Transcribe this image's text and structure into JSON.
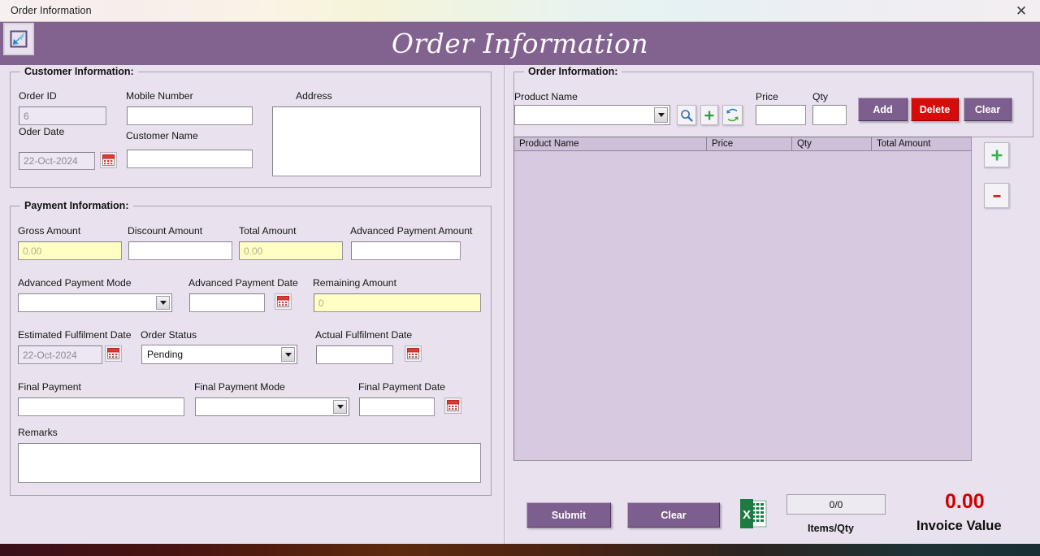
{
  "window": {
    "title": "Order Information",
    "close_label": "✕",
    "app_icon": "download-arrow-icon"
  },
  "header": {
    "title": "Order Information",
    "background_color": "#82638f",
    "text_color": "#fdfbff"
  },
  "customer_group": {
    "title": "Customer Information:",
    "order_id": {
      "label": "Order ID",
      "value": "6",
      "readonly": true
    },
    "order_date": {
      "label": "Oder Date",
      "value": "22-Oct-2024",
      "readonly": true
    },
    "mobile_number": {
      "label": "Mobile Number",
      "value": ""
    },
    "customer_name": {
      "label": "Customer Name",
      "value": ""
    },
    "address": {
      "label": "Address",
      "value": ""
    }
  },
  "payment_group": {
    "title": "Payment Information:",
    "gross_amount": {
      "label": "Gross Amount",
      "value": "0.00",
      "style": "yellow-readonly"
    },
    "discount_amount": {
      "label": "Discount Amount",
      "value": ""
    },
    "total_amount": {
      "label": "Total Amount",
      "value": "0.00",
      "style": "yellow-readonly"
    },
    "advanced_payment_amount": {
      "label": "Advanced Payment Amount",
      "value": ""
    },
    "advanced_payment_mode": {
      "label": "Advanced Payment Mode",
      "value": "",
      "options": []
    },
    "advanced_payment_date": {
      "label": "Advanced Payment Date",
      "value": ""
    },
    "remaining_amount": {
      "label": "Remaining Amount",
      "value": "0",
      "style": "yellow-readonly"
    },
    "estimated_fulfilment_date": {
      "label": "Estimated Fulfilment Date",
      "value": "22-Oct-2024",
      "readonly": true
    },
    "order_status": {
      "label": "Order Status",
      "value": "Pending",
      "options": [
        "Pending"
      ]
    },
    "actual_fulfilment_date": {
      "label": "Actual Fulfilment Date",
      "value": ""
    },
    "final_payment": {
      "label": "Final Payment",
      "value": ""
    },
    "final_payment_mode": {
      "label": "Final Payment Mode",
      "value": "",
      "options": []
    },
    "final_payment_date": {
      "label": "Final Payment Date",
      "value": ""
    },
    "remarks": {
      "label": "Remarks",
      "value": ""
    }
  },
  "order_group": {
    "title": "Order Information:",
    "product_name": {
      "label": "Product Name",
      "value": "",
      "options": []
    },
    "price": {
      "label": "Price",
      "value": ""
    },
    "qty": {
      "label": "Qty",
      "value": ""
    },
    "search_icon": "magnifier-icon",
    "add_product_icon": "green-plus-icon",
    "refresh_icon": "refresh-arrows-icon",
    "buttons": {
      "add": {
        "label": "Add",
        "color": "#7d5f8f"
      },
      "delete": {
        "label": "Delete",
        "color": "#d80b0b"
      },
      "clear": {
        "label": "Clear",
        "color": "#7d5f8f"
      }
    },
    "grid": {
      "columns": [
        "Product Name",
        "Price",
        "Qty",
        "Total Amount"
      ],
      "rows": []
    },
    "row_add_icon": "green-plus-icon",
    "row_remove_icon": "red-minus-icon"
  },
  "footer": {
    "submit": {
      "label": "Submit"
    },
    "clear": {
      "label": "Clear"
    },
    "excel_icon": "excel-export-icon",
    "items_qty": {
      "value": "0/0",
      "caption": "Items/Qty"
    },
    "invoice": {
      "value": "0.00",
      "caption": "Invoice Value",
      "color": "#d00000"
    }
  }
}
